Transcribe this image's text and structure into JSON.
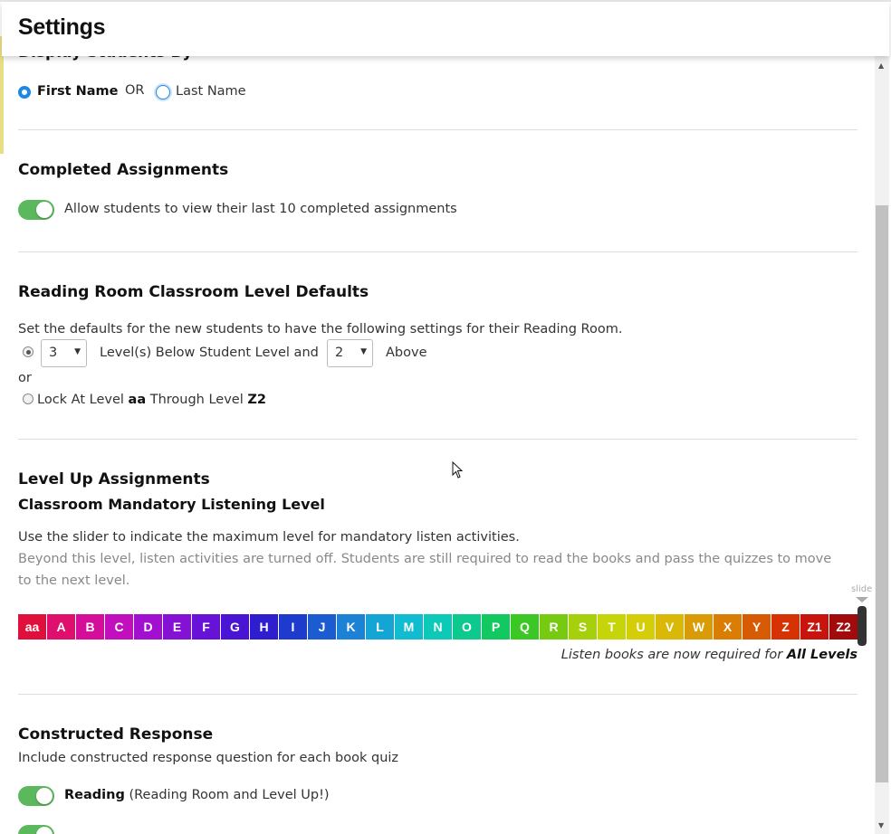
{
  "header": {
    "title": "Settings"
  },
  "display_students": {
    "heading": "Display Students By",
    "first_name": "First Name",
    "or": "OR",
    "last_name": "Last Name"
  },
  "completed": {
    "heading": "Completed Assignments",
    "toggle_label": "Allow students to view their last 10 completed assignments"
  },
  "reading_room": {
    "heading": "Reading Room Classroom Level Defaults",
    "description": "Set the defaults for the new students to have the following settings for their Reading Room.",
    "below_value": "3",
    "below_label": "Level(s) Below Student Level and",
    "above_value": "2",
    "above_label": "Above",
    "or": "or",
    "lock_prefix": "Lock At Level",
    "lock_from": "aa",
    "lock_mid": "Through Level",
    "lock_to": "Z2"
  },
  "level_up": {
    "heading": "Level Up Assignments",
    "subheading": "Classroom Mandatory Listening Level",
    "line1": "Use the slider to indicate the maximum level for mandatory listen activities.",
    "line2a": "Beyond this level, listen activities are turned off. Students are still required to read the books and pass the quizzes to move",
    "line2b": "to the next level.",
    "slide_label": "slide",
    "levels": [
      "aa",
      "A",
      "B",
      "C",
      "D",
      "E",
      "F",
      "G",
      "H",
      "I",
      "J",
      "K",
      "L",
      "M",
      "N",
      "O",
      "P",
      "Q",
      "R",
      "S",
      "T",
      "U",
      "V",
      "W",
      "X",
      "Y",
      "Z",
      "Z1",
      "Z2"
    ],
    "level_colors": [
      "#e0103c",
      "#de0f6d",
      "#d40e9a",
      "#c20fbe",
      "#a30fd0",
      "#8411d4",
      "#6712d6",
      "#4a14d4",
      "#2e1ed0",
      "#1d3ccd",
      "#1b5dd0",
      "#1c82d6",
      "#15a5d4",
      "#11bcd0",
      "#0dc9b8",
      "#0dc98e",
      "#12c860",
      "#3bc824",
      "#76cb10",
      "#a6cf0c",
      "#c6d40a",
      "#d6cd09",
      "#d9b808",
      "#d99c06",
      "#d97d05",
      "#d75a04",
      "#d63203",
      "#c8140c",
      "#a10b0b"
    ],
    "status_prefix": "Listen books are now required for",
    "status_value": "All Levels"
  },
  "constructed": {
    "heading": "Constructed Response",
    "description": "Include constructed response question for each book quiz",
    "reading_bold": "Reading",
    "reading_rest": "(Reading Room and Level Up!)"
  }
}
